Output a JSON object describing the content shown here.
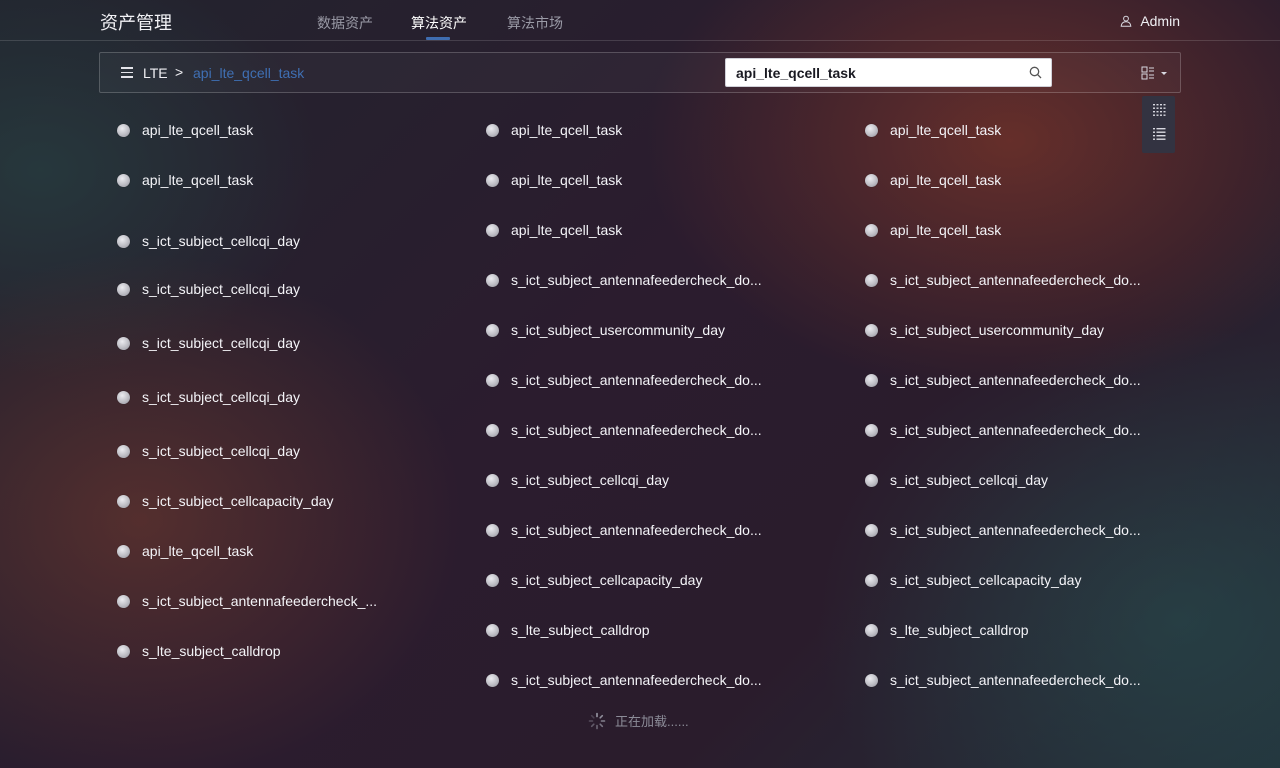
{
  "header": {
    "title": "资产管理",
    "tabs": [
      {
        "label": "数据资产",
        "active": false
      },
      {
        "label": "算法资产",
        "active": true
      },
      {
        "label": "算法市场",
        "active": false
      }
    ],
    "user": {
      "icon": "user-icon",
      "name": "Admin"
    },
    "accent_color": "#3f6db0"
  },
  "toolbar": {
    "menu_icon": "menu-icon",
    "breadcrumb": {
      "root": "LTE",
      "separator": ">",
      "current": "api_lte_qcell_task"
    },
    "search": {
      "value": "api_lte_qcell_task",
      "placeholder": "",
      "icon": "search-icon"
    },
    "view_toggle_icon": "grid-view-icon",
    "view_options": [
      {
        "icon": "grid-dots-icon"
      },
      {
        "icon": "list-icon"
      }
    ]
  },
  "columns": [
    [
      "api_lte_qcell_task",
      "api_lte_qcell_task",
      "s_ict_subject_cellcqi_day",
      "s_ict_subject_cellcqi_day",
      "s_ict_subject_cellcqi_day",
      "s_ict_subject_cellcqi_day",
      "s_ict_subject_cellcqi_day",
      "s_ict_subject_cellcapacity_day",
      "api_lte_qcell_task",
      "s_ict_subject_antennafeedercheck_...",
      "s_lte_subject_calldrop"
    ],
    [
      "api_lte_qcell_task",
      "api_lte_qcell_task",
      "api_lte_qcell_task",
      "s_ict_subject_antennafeedercheck_do...",
      "s_ict_subject_usercommunity_day",
      "s_ict_subject_antennafeedercheck_do...",
      "s_ict_subject_antennafeedercheck_do...",
      "s_ict_subject_cellcqi_day",
      "s_ict_subject_antennafeedercheck_do...",
      "s_ict_subject_cellcapacity_day",
      "s_lte_subject_calldrop",
      "s_ict_subject_antennafeedercheck_do..."
    ],
    [
      "api_lte_qcell_task",
      "api_lte_qcell_task",
      "api_lte_qcell_task",
      "s_ict_subject_antennafeedercheck_do...",
      "s_ict_subject_usercommunity_day",
      "s_ict_subject_antennafeedercheck_do...",
      "s_ict_subject_antennafeedercheck_do...",
      "s_ict_subject_cellcqi_day",
      "s_ict_subject_antennafeedercheck_do...",
      "s_ict_subject_cellcapacity_day",
      "s_lte_subject_calldrop",
      "s_ict_subject_antennafeedercheck_do..."
    ]
  ],
  "loading": {
    "icon": "spinner-icon",
    "text": "正在加载......"
  }
}
